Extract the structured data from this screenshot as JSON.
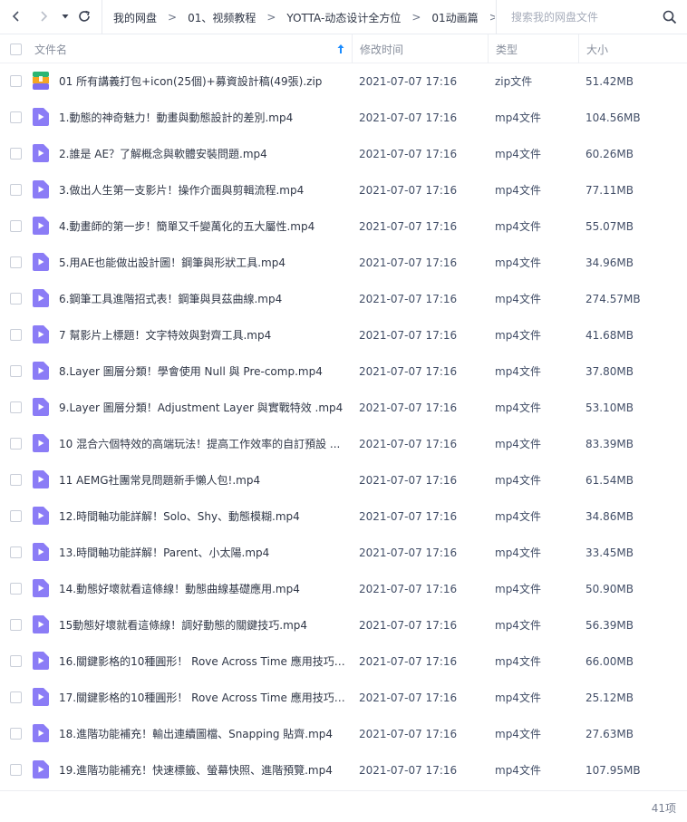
{
  "nav": {
    "breadcrumbs": [
      "我的网盘",
      "01、视频教程",
      "YOTTA-动态设计全方位",
      "01动画篇"
    ],
    "search_placeholder": "搜索我的网盘文件"
  },
  "columns": {
    "name": "文件名",
    "modified": "修改时间",
    "type": "类型",
    "size": "大小"
  },
  "colors": {
    "video_icon": "#8b7cf6",
    "zip_icon_top": "#2bb673",
    "zip_icon_mid": "#f5a623",
    "zip_icon_bottom": "#7d6df0"
  },
  "files": [
    {
      "name": "01 所有講義打包+icon(25個)+募資設計稿(49張).zip",
      "time": "2021-07-07 17:16",
      "type": "zip文件",
      "size": "51.42MB",
      "icon": "zip-archive-icon"
    },
    {
      "name": "1.動態的神奇魅力！動畫與動態設計的差別.mp4",
      "time": "2021-07-07 17:16",
      "type": "mp4文件",
      "size": "104.56MB",
      "icon": "video-file-icon"
    },
    {
      "name": "2.誰是 AE？了解概念與軟體安裝問題.mp4",
      "time": "2021-07-07 17:16",
      "type": "mp4文件",
      "size": "60.26MB",
      "icon": "video-file-icon"
    },
    {
      "name": "3.做出人生第一支影片！操作介面與剪輯流程.mp4",
      "time": "2021-07-07 17:16",
      "type": "mp4文件",
      "size": "77.11MB",
      "icon": "video-file-icon"
    },
    {
      "name": "4.動畫師的第一步！簡單又千變萬化的五大屬性.mp4",
      "time": "2021-07-07 17:16",
      "type": "mp4文件",
      "size": "55.07MB",
      "icon": "video-file-icon"
    },
    {
      "name": "5.用AE也能做出設計圖！鋼筆與形狀工具.mp4",
      "time": "2021-07-07 17:16",
      "type": "mp4文件",
      "size": "34.96MB",
      "icon": "video-file-icon"
    },
    {
      "name": "6.鋼筆工具進階招式表！鋼筆與貝茲曲線.mp4",
      "time": "2021-07-07 17:16",
      "type": "mp4文件",
      "size": "274.57MB",
      "icon": "video-file-icon"
    },
    {
      "name": "7 幫影片上標題！文字特效與對齊工具.mp4",
      "time": "2021-07-07 17:16",
      "type": "mp4文件",
      "size": "41.68MB",
      "icon": "video-file-icon"
    },
    {
      "name": "8.Layer 圖層分類！學會使用 Null 與 Pre-comp.mp4",
      "time": "2021-07-07 17:16",
      "type": "mp4文件",
      "size": "37.80MB",
      "icon": "video-file-icon"
    },
    {
      "name": "9.Layer 圖層分類！Adjustment Layer 與實戰特效 .mp4",
      "time": "2021-07-07 17:16",
      "type": "mp4文件",
      "size": "53.10MB",
      "icon": "video-file-icon"
    },
    {
      "name": "10 混合六個特效的高端玩法！提高工作效率的自訂預設 ...",
      "time": "2021-07-07 17:16",
      "type": "mp4文件",
      "size": "83.39MB",
      "icon": "video-file-icon"
    },
    {
      "name": "11 AEMG社團常見問題新手懶人包!.mp4",
      "time": "2021-07-07 17:16",
      "type": "mp4文件",
      "size": "61.54MB",
      "icon": "video-file-icon"
    },
    {
      "name": "12.時間軸功能詳解！Solo、Shy、動態模糊.mp4",
      "time": "2021-07-07 17:16",
      "type": "mp4文件",
      "size": "34.86MB",
      "icon": "video-file-icon"
    },
    {
      "name": "13.時間軸功能詳解！Parent、小太陽.mp4",
      "time": "2021-07-07 17:16",
      "type": "mp4文件",
      "size": "33.45MB",
      "icon": "video-file-icon"
    },
    {
      "name": "14.動態好壞就看這條線！動態曲線基礎應用.mp4",
      "time": "2021-07-07 17:16",
      "type": "mp4文件",
      "size": "50.90MB",
      "icon": "video-file-icon"
    },
    {
      "name": "15動態好壞就看這條線！調好動態的關鍵技巧.mp4",
      "time": "2021-07-07 17:16",
      "type": "mp4文件",
      "size": "56.39MB",
      "icon": "video-file-icon"
    },
    {
      "name": "16.關鍵影格的10種圓形！ Rove Across Time 應用技巧....",
      "time": "2021-07-07 17:16",
      "type": "mp4文件",
      "size": "66.00MB",
      "icon": "video-file-icon"
    },
    {
      "name": "17.關鍵影格的10種圓形！ Rove Across Time 應用技巧....",
      "time": "2021-07-07 17:16",
      "type": "mp4文件",
      "size": "25.12MB",
      "icon": "video-file-icon"
    },
    {
      "name": "18.進階功能補充！輸出連續圖檔、Snapping 貼齊.mp4",
      "time": "2021-07-07 17:16",
      "type": "mp4文件",
      "size": "27.63MB",
      "icon": "video-file-icon"
    },
    {
      "name": "19.進階功能補充！快速標籤、螢幕快照、進階預覽.mp4",
      "time": "2021-07-07 17:16",
      "type": "mp4文件",
      "size": "107.95MB",
      "icon": "video-file-icon"
    }
  ],
  "footer": {
    "count": "41项"
  }
}
